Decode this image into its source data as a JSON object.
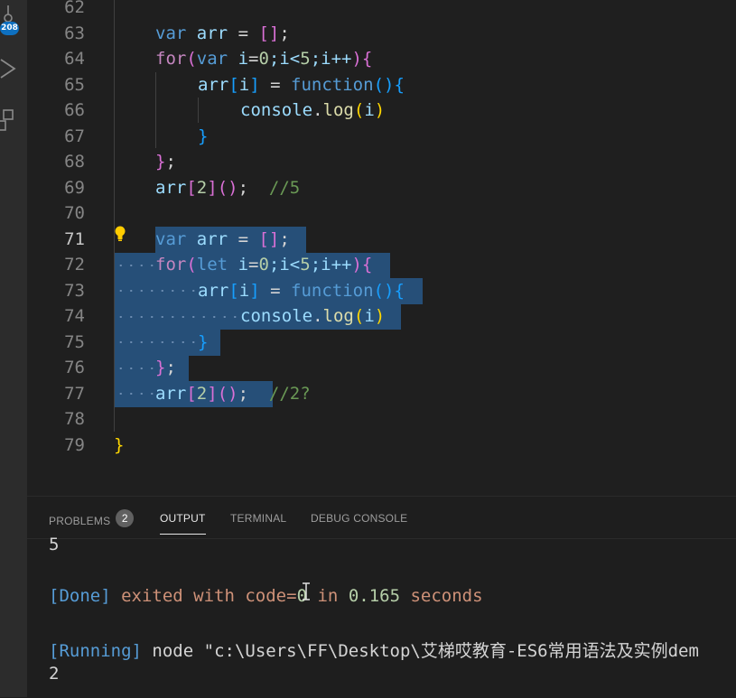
{
  "activity_bar": {
    "badge": "208"
  },
  "editor": {
    "active_line": "71",
    "lines": [
      {
        "num": "62"
      },
      {
        "num": "63",
        "a": "var",
        "b": "arr",
        "c": "=",
        "d": "[",
        "e": "]",
        "f": ";"
      },
      {
        "num": "64",
        "a": "for",
        "b": "(",
        "c": "var",
        "d": "i",
        "e": "=",
        "f": "0",
        "g": ";i<",
        "h": "5",
        "i": ";i++",
        "j": ")",
        "k": "{"
      },
      {
        "num": "65",
        "a": "arr",
        "b": "[",
        "c": "i",
        "d": "]",
        "e": "=",
        "f": "function",
        "g": "()",
        "h": "{"
      },
      {
        "num": "66",
        "a": "console",
        "b": ".",
        "c": "log",
        "d": "(",
        "e": "i",
        "f": ")"
      },
      {
        "num": "67",
        "a": "}"
      },
      {
        "num": "68",
        "a": "}",
        "b": ";"
      },
      {
        "num": "69",
        "a": "arr",
        "b": "[",
        "c": "2",
        "d": "]",
        "e": "()",
        "f": ";",
        "g": "//5"
      },
      {
        "num": "70"
      },
      {
        "num": "71",
        "a": "var",
        "b": "arr",
        "c": "=",
        "d": "[",
        "e": "]",
        "f": ";"
      },
      {
        "num": "72",
        "a": "for",
        "b": "(",
        "c": "let",
        "d": "i",
        "e": "=",
        "f": "0",
        "g": ";i<",
        "h": "5",
        "i": ";i++",
        "j": ")",
        "k": "{"
      },
      {
        "num": "73",
        "a": "arr",
        "b": "[",
        "c": "i",
        "d": "]",
        "e": "=",
        "f": "function",
        "g": "()",
        "h": "{"
      },
      {
        "num": "74",
        "a": "console",
        "b": ".",
        "c": "log",
        "d": "(",
        "e": "i",
        "f": ")"
      },
      {
        "num": "75",
        "a": "}"
      },
      {
        "num": "76",
        "a": "}",
        "b": ";"
      },
      {
        "num": "77",
        "a": "arr",
        "b": "[",
        "c": "2",
        "d": "]",
        "e": "()",
        "f": ";",
        "g": "//2?"
      },
      {
        "num": "78"
      },
      {
        "num": "79",
        "a": "}"
      }
    ]
  },
  "panel": {
    "tabs": [
      {
        "label": "PROBLEMS",
        "count": "2"
      },
      {
        "label": "OUTPUT"
      },
      {
        "label": "TERMINAL"
      },
      {
        "label": "DEBUG CONSOLE"
      }
    ],
    "active_tab": "OUTPUT",
    "output": {
      "line1": "5",
      "done_tag": "[Done]",
      "done_text": "exited with code=",
      "done_code": "0",
      "done_in": "in",
      "done_time": "0.165",
      "done_unit": "seconds",
      "running_tag": "[Running]",
      "running_cmd": "node",
      "running_path": "\"c:\\Users\\FF\\Desktop\\艾梯哎教育-ES6常用语法及实例dem",
      "line_last": "2"
    }
  },
  "colors": {
    "editor_bg": "#1f1f1f",
    "selection": "#264f78",
    "keyword": "#c586c0",
    "storage": "#569cd6",
    "variable": "#9cdcfe",
    "function": "#dcdcaa",
    "number": "#b5cea8",
    "comment": "#6a9955",
    "bracket1": "#ffd700",
    "bracket2": "#da70d6",
    "bracket3": "#179fff"
  }
}
